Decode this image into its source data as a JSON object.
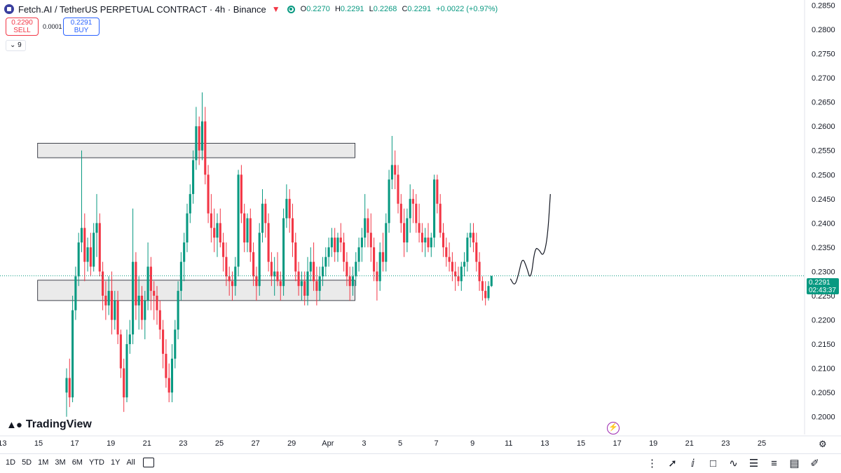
{
  "header": {
    "symbol": "Fetch.AI / TetherUS PERPETUAL CONTRACT · 4h · Binance",
    "ohlc": {
      "o_label": "O",
      "o": "0.2270",
      "h_label": "H",
      "h": "0.2291",
      "l_label": "L",
      "l": "0.2268",
      "c_label": "C",
      "c": "0.2291",
      "change": "+0.0022 (+0.97%)"
    }
  },
  "trade": {
    "sell_price": "0.2290",
    "sell_label": "SELL",
    "spread": "0.0001",
    "buy_price": "0.2291",
    "buy_label": "BUY"
  },
  "indicator_toggle": {
    "label": "9"
  },
  "price_label": {
    "price": "0.2291",
    "countdown": "02:43:37"
  },
  "branding": {
    "name": "TradingView"
  },
  "timeframes": [
    "1D",
    "5D",
    "1M",
    "3M",
    "6M",
    "YTD",
    "1Y",
    "All"
  ],
  "colors": {
    "up": "#089981",
    "down": "#f23645",
    "zone_fill": "#e6e6e6",
    "zone_border": "#131722",
    "grid": "#f0f3fa"
  },
  "chart_data": {
    "type": "candlestick",
    "title": "Fetch.AI / TetherUS PERPETUAL CONTRACT · 4h · Binance",
    "ylim": [
      0.1975,
      0.2855
    ],
    "y_ticks": [
      0.2,
      0.205,
      0.21,
      0.215,
      0.22,
      0.225,
      0.23,
      0.235,
      0.24,
      0.245,
      0.25,
      0.255,
      0.26,
      0.265,
      0.27,
      0.275,
      0.28,
      0.285
    ],
    "y_tick_labels": [
      "0.2000",
      "0.2050",
      "0.2100",
      "0.2150",
      "0.2200",
      "0.2250",
      "0.2300",
      "0.2350",
      "0.2400",
      "0.2450",
      "0.2500",
      "0.2550",
      "0.2600",
      "0.2650",
      "0.2700",
      "0.2750",
      "0.2800",
      "0.2850"
    ],
    "x_labels": [
      "13",
      "15",
      "17",
      "19",
      "21",
      "23",
      "25",
      "27",
      "29",
      "Apr",
      "3",
      "5",
      "7",
      "9",
      "11",
      "13",
      "15",
      "17",
      "19",
      "21",
      "23",
      "25"
    ],
    "x_label_day_index": [
      -2,
      0,
      2,
      4,
      6,
      8,
      10,
      12,
      14,
      16,
      18,
      20,
      22,
      24,
      26,
      28,
      30,
      32,
      34,
      36,
      38,
      40
    ],
    "candles_per_day": 6,
    "candles": [
      [
        0.205,
        0.21,
        0.2,
        0.208
      ],
      [
        0.208,
        0.212,
        0.202,
        0.204
      ],
      [
        0.204,
        0.225,
        0.203,
        0.222
      ],
      [
        0.222,
        0.231,
        0.22,
        0.229
      ],
      [
        0.229,
        0.238,
        0.227,
        0.236
      ],
      [
        0.236,
        0.255,
        0.234,
        0.239
      ],
      [
        0.239,
        0.242,
        0.228,
        0.232
      ],
      [
        0.232,
        0.237,
        0.23,
        0.235
      ],
      [
        0.235,
        0.238,
        0.229,
        0.231
      ],
      [
        0.231,
        0.24,
        0.23,
        0.238
      ],
      [
        0.238,
        0.246,
        0.233,
        0.24
      ],
      [
        0.24,
        0.242,
        0.229,
        0.23
      ],
      [
        0.23,
        0.232,
        0.222,
        0.225
      ],
      [
        0.225,
        0.228,
        0.22,
        0.223
      ],
      [
        0.223,
        0.229,
        0.221,
        0.226
      ],
      [
        0.226,
        0.23,
        0.217,
        0.22
      ],
      [
        0.22,
        0.226,
        0.218,
        0.224
      ],
      [
        0.224,
        0.226,
        0.215,
        0.217
      ],
      [
        0.217,
        0.218,
        0.208,
        0.21
      ],
      [
        0.21,
        0.212,
        0.201,
        0.204
      ],
      [
        0.204,
        0.218,
        0.203,
        0.215
      ],
      [
        0.215,
        0.22,
        0.213,
        0.217
      ],
      [
        0.217,
        0.243,
        0.215,
        0.232
      ],
      [
        0.232,
        0.234,
        0.22,
        0.223
      ],
      [
        0.223,
        0.229,
        0.218,
        0.225
      ],
      [
        0.225,
        0.227,
        0.218,
        0.22
      ],
      [
        0.22,
        0.226,
        0.216,
        0.224
      ],
      [
        0.224,
        0.236,
        0.222,
        0.231
      ],
      [
        0.231,
        0.233,
        0.222,
        0.226
      ],
      [
        0.226,
        0.228,
        0.22,
        0.225
      ],
      [
        0.225,
        0.227,
        0.219,
        0.222
      ],
      [
        0.222,
        0.224,
        0.216,
        0.218
      ],
      [
        0.218,
        0.22,
        0.21,
        0.213
      ],
      [
        0.213,
        0.216,
        0.206,
        0.208
      ],
      [
        0.208,
        0.211,
        0.203,
        0.205
      ],
      [
        0.205,
        0.215,
        0.203,
        0.212
      ],
      [
        0.212,
        0.22,
        0.21,
        0.218
      ],
      [
        0.218,
        0.228,
        0.216,
        0.226
      ],
      [
        0.226,
        0.234,
        0.224,
        0.232
      ],
      [
        0.232,
        0.238,
        0.228,
        0.236
      ],
      [
        0.236,
        0.244,
        0.234,
        0.242
      ],
      [
        0.242,
        0.248,
        0.24,
        0.246
      ],
      [
        0.246,
        0.255,
        0.244,
        0.253
      ],
      [
        0.253,
        0.264,
        0.251,
        0.26
      ],
      [
        0.26,
        0.262,
        0.252,
        0.255
      ],
      [
        0.255,
        0.267,
        0.253,
        0.261
      ],
      [
        0.261,
        0.264,
        0.248,
        0.25
      ],
      [
        0.25,
        0.252,
        0.24,
        0.242
      ],
      [
        0.242,
        0.246,
        0.236,
        0.239
      ],
      [
        0.239,
        0.243,
        0.234,
        0.237
      ],
      [
        0.237,
        0.242,
        0.233,
        0.24
      ],
      [
        0.24,
        0.243,
        0.235,
        0.236
      ],
      [
        0.236,
        0.238,
        0.23,
        0.233
      ],
      [
        0.233,
        0.236,
        0.227,
        0.229
      ],
      [
        0.229,
        0.231,
        0.225,
        0.228
      ],
      [
        0.228,
        0.23,
        0.224,
        0.227
      ],
      [
        0.227,
        0.233,
        0.225,
        0.231
      ],
      [
        0.231,
        0.251,
        0.229,
        0.25
      ],
      [
        0.25,
        0.252,
        0.24,
        0.242
      ],
      [
        0.242,
        0.244,
        0.234,
        0.236
      ],
      [
        0.236,
        0.242,
        0.234,
        0.241
      ],
      [
        0.241,
        0.243,
        0.232,
        0.234
      ],
      [
        0.234,
        0.236,
        0.227,
        0.229
      ],
      [
        0.229,
        0.231,
        0.224,
        0.227
      ],
      [
        0.227,
        0.24,
        0.225,
        0.238
      ],
      [
        0.238,
        0.247,
        0.236,
        0.244
      ],
      [
        0.244,
        0.245,
        0.237,
        0.24
      ],
      [
        0.24,
        0.242,
        0.23,
        0.232
      ],
      [
        0.232,
        0.234,
        0.227,
        0.229
      ],
      [
        0.229,
        0.233,
        0.225,
        0.23
      ],
      [
        0.23,
        0.234,
        0.227,
        0.228
      ],
      [
        0.228,
        0.23,
        0.224,
        0.227
      ],
      [
        0.227,
        0.243,
        0.225,
        0.241
      ],
      [
        0.241,
        0.248,
        0.239,
        0.245
      ],
      [
        0.245,
        0.247,
        0.238,
        0.241
      ],
      [
        0.241,
        0.244,
        0.233,
        0.236
      ],
      [
        0.236,
        0.238,
        0.228,
        0.23
      ],
      [
        0.23,
        0.232,
        0.225,
        0.227
      ],
      [
        0.227,
        0.23,
        0.224,
        0.228
      ],
      [
        0.228,
        0.23,
        0.223,
        0.225
      ],
      [
        0.225,
        0.233,
        0.223,
        0.23
      ],
      [
        0.23,
        0.235,
        0.228,
        0.232
      ],
      [
        0.232,
        0.236,
        0.226,
        0.228
      ],
      [
        0.228,
        0.231,
        0.223,
        0.226
      ],
      [
        0.226,
        0.231,
        0.224,
        0.229
      ],
      [
        0.229,
        0.233,
        0.227,
        0.231
      ],
      [
        0.231,
        0.235,
        0.229,
        0.233
      ],
      [
        0.233,
        0.237,
        0.231,
        0.235
      ],
      [
        0.235,
        0.239,
        0.233,
        0.237
      ],
      [
        0.237,
        0.239,
        0.232,
        0.234
      ],
      [
        0.234,
        0.238,
        0.232,
        0.237
      ],
      [
        0.237,
        0.24,
        0.234,
        0.236
      ],
      [
        0.236,
        0.238,
        0.23,
        0.232
      ],
      [
        0.232,
        0.234,
        0.227,
        0.229
      ],
      [
        0.229,
        0.231,
        0.224,
        0.227
      ],
      [
        0.227,
        0.231,
        0.225,
        0.229
      ],
      [
        0.229,
        0.234,
        0.227,
        0.232
      ],
      [
        0.232,
        0.237,
        0.23,
        0.235
      ],
      [
        0.235,
        0.239,
        0.232,
        0.237
      ],
      [
        0.237,
        0.246,
        0.235,
        0.241
      ],
      [
        0.241,
        0.243,
        0.235,
        0.238
      ],
      [
        0.238,
        0.242,
        0.232,
        0.235
      ],
      [
        0.235,
        0.237,
        0.228,
        0.23
      ],
      [
        0.23,
        0.232,
        0.224,
        0.228
      ],
      [
        0.228,
        0.236,
        0.226,
        0.234
      ],
      [
        0.234,
        0.238,
        0.23,
        0.232
      ],
      [
        0.232,
        0.242,
        0.23,
        0.24
      ],
      [
        0.24,
        0.251,
        0.238,
        0.249
      ],
      [
        0.249,
        0.258,
        0.247,
        0.252
      ],
      [
        0.252,
        0.255,
        0.247,
        0.25
      ],
      [
        0.25,
        0.252,
        0.242,
        0.244
      ],
      [
        0.244,
        0.246,
        0.238,
        0.24
      ],
      [
        0.24,
        0.243,
        0.233,
        0.236
      ],
      [
        0.236,
        0.243,
        0.234,
        0.241
      ],
      [
        0.241,
        0.248,
        0.238,
        0.245
      ],
      [
        0.245,
        0.247,
        0.24,
        0.244
      ],
      [
        0.244,
        0.246,
        0.238,
        0.24
      ],
      [
        0.24,
        0.244,
        0.236,
        0.238
      ],
      [
        0.238,
        0.24,
        0.234,
        0.236
      ],
      [
        0.236,
        0.239,
        0.233,
        0.237
      ],
      [
        0.237,
        0.24,
        0.234,
        0.235
      ],
      [
        0.235,
        0.238,
        0.233,
        0.237
      ],
      [
        0.237,
        0.25,
        0.235,
        0.249
      ],
      [
        0.249,
        0.25,
        0.242,
        0.244
      ],
      [
        0.244,
        0.246,
        0.237,
        0.238
      ],
      [
        0.238,
        0.24,
        0.233,
        0.235
      ],
      [
        0.235,
        0.237,
        0.231,
        0.233
      ],
      [
        0.233,
        0.236,
        0.23,
        0.232
      ],
      [
        0.232,
        0.234,
        0.228,
        0.23
      ],
      [
        0.23,
        0.232,
        0.226,
        0.229
      ],
      [
        0.229,
        0.231,
        0.227,
        0.228
      ],
      [
        0.228,
        0.232,
        0.226,
        0.231
      ],
      [
        0.231,
        0.234,
        0.229,
        0.232
      ],
      [
        0.232,
        0.238,
        0.23,
        0.237
      ],
      [
        0.237,
        0.24,
        0.235,
        0.238
      ],
      [
        0.238,
        0.24,
        0.234,
        0.236
      ],
      [
        0.236,
        0.238,
        0.23,
        0.232
      ],
      [
        0.232,
        0.234,
        0.226,
        0.228
      ],
      [
        0.228,
        0.229,
        0.224,
        0.226
      ],
      [
        0.226,
        0.228,
        0.223,
        0.2245
      ],
      [
        0.2245,
        0.228,
        0.224,
        0.227
      ],
      [
        0.227,
        0.2291,
        0.2268,
        0.2291
      ]
    ],
    "zones": [
      {
        "name": "resistance",
        "from_day": -0.05,
        "to_day": 17.5,
        "low": 0.2535,
        "high": 0.2565
      },
      {
        "name": "support",
        "from_day": -0.05,
        "to_day": 17.5,
        "low": 0.224,
        "high": 0.2282
      }
    ],
    "last_price": 0.2291
  }
}
